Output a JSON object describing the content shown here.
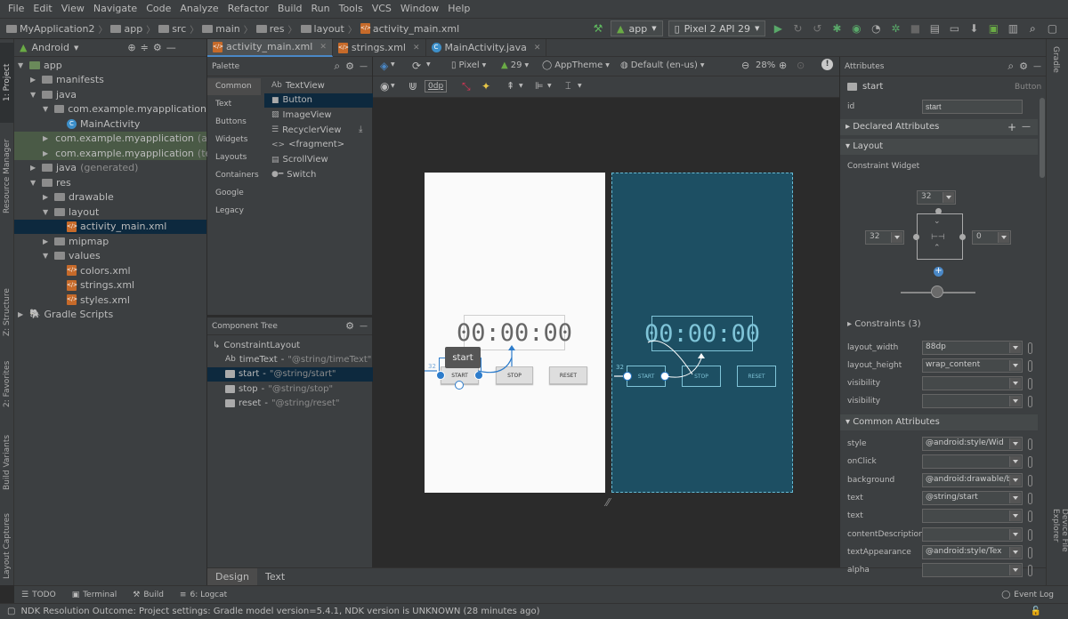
{
  "menu": [
    "File",
    "Edit",
    "View",
    "Navigate",
    "Code",
    "Analyze",
    "Refactor",
    "Build",
    "Run",
    "Tools",
    "VCS",
    "Window",
    "Help"
  ],
  "breadcrumbs": [
    "MyApplication2",
    "app",
    "src",
    "main",
    "res",
    "layout",
    "activity_main.xml"
  ],
  "toolbar": {
    "run_config": "app",
    "device": "Pixel 2 API 29"
  },
  "left_tabs": [
    "1: Project",
    "Resource Manager",
    "Z: Structure",
    "2: Favorites",
    "Build Variants",
    "Layout Captures"
  ],
  "right_tabs": [
    "Gradle",
    "Device File Explorer"
  ],
  "project": {
    "view_mode": "Android",
    "items": [
      {
        "label": "app",
        "depth": 0,
        "open": true
      },
      {
        "label": "manifests",
        "depth": 1,
        "open": false
      },
      {
        "label": "java",
        "depth": 1,
        "open": true
      },
      {
        "label": "com.example.myapplication",
        "depth": 2,
        "open": true
      },
      {
        "label": "MainActivity",
        "depth": 3
      },
      {
        "label": "com.example.myapplication",
        "suffix": "(androidTest)",
        "depth": 2,
        "open": false
      },
      {
        "label": "com.example.myapplication",
        "suffix": "(test)",
        "depth": 2,
        "open": false
      },
      {
        "label": "java",
        "suffix": "(generated)",
        "depth": 1,
        "open": false
      },
      {
        "label": "res",
        "depth": 1,
        "open": true
      },
      {
        "label": "drawable",
        "depth": 2,
        "open": false
      },
      {
        "label": "layout",
        "depth": 2,
        "open": true
      },
      {
        "label": "activity_main.xml",
        "depth": 3
      },
      {
        "label": "mipmap",
        "depth": 2,
        "open": false
      },
      {
        "label": "values",
        "depth": 2,
        "open": true
      },
      {
        "label": "colors.xml",
        "depth": 3
      },
      {
        "label": "strings.xml",
        "depth": 3
      },
      {
        "label": "styles.xml",
        "depth": 3
      },
      {
        "label": "Gradle Scripts",
        "depth": 0,
        "open": false
      }
    ]
  },
  "editor_tabs": [
    "activity_main.xml",
    "strings.xml",
    "MainActivity.java"
  ],
  "palette": {
    "title": "Palette",
    "categories": [
      "Common",
      "Text",
      "Buttons",
      "Widgets",
      "Layouts",
      "Containers",
      "Google",
      "Legacy"
    ],
    "items": [
      "TextView",
      "Button",
      "ImageView",
      "RecyclerView",
      "<fragment>",
      "ScrollView",
      "Switch"
    ]
  },
  "component_tree": {
    "title": "Component Tree",
    "root": "ConstraintLayout",
    "children": [
      {
        "name": "timeText",
        "value": "\"@string/timeText\""
      },
      {
        "name": "start",
        "value": "\"@string/start\""
      },
      {
        "name": "stop",
        "value": "\"@string/stop\""
      },
      {
        "name": "reset",
        "value": "\"@string/reset\""
      }
    ]
  },
  "design_toolbar": {
    "device": "Pixel",
    "api": "29",
    "theme": "AppTheme",
    "locale": "Default (en-us)",
    "zoom": "28%",
    "margin": "0dp"
  },
  "preview": {
    "time": "00:00:00",
    "start": "START",
    "stop": "STOP",
    "reset": "RESET",
    "tooltip": "start",
    "margin_label": "32"
  },
  "attributes": {
    "title": "Attributes",
    "component_name": "start",
    "component_type": "Button",
    "id_label": "id",
    "id_value": "start",
    "declared": "Declared Attributes",
    "layout": "Layout",
    "constraint_widget": "Constraint Widget",
    "margin_top": "32",
    "margin_left": "32",
    "margin_right": "0",
    "constraints": "Constraints (3)",
    "rows": [
      {
        "label": "layout_width",
        "value": "88dp"
      },
      {
        "label": "layout_height",
        "value": "wrap_content"
      },
      {
        "label": "visibility",
        "value": ""
      },
      {
        "label": "visibility",
        "value": ""
      }
    ],
    "common": "Common Attributes",
    "common_rows": [
      {
        "label": "style",
        "value": "@android:style/Wid"
      },
      {
        "label": "onClick",
        "value": ""
      },
      {
        "label": "background",
        "value": "@android:drawable/b"
      },
      {
        "label": "text",
        "value": "@string/start"
      },
      {
        "label": "text",
        "value": ""
      },
      {
        "label": "contentDescription",
        "value": ""
      },
      {
        "label": "textAppearance",
        "value": "@android:style/Tex"
      },
      {
        "label": "alpha",
        "value": ""
      }
    ]
  },
  "bottom_tabs": [
    "Design",
    "Text"
  ],
  "tool_windows": [
    "TODO",
    "Terminal",
    "Build",
    "6: Logcat"
  ],
  "event_log": "Event Log",
  "status": "NDK Resolution Outcome: Project settings: Gradle model version=5.4.1, NDK version is UNKNOWN (28 minutes ago)",
  "colors": {
    "accent": "#4a88c7",
    "blueprint": "#1d4f63",
    "selection": "#0d293e"
  }
}
